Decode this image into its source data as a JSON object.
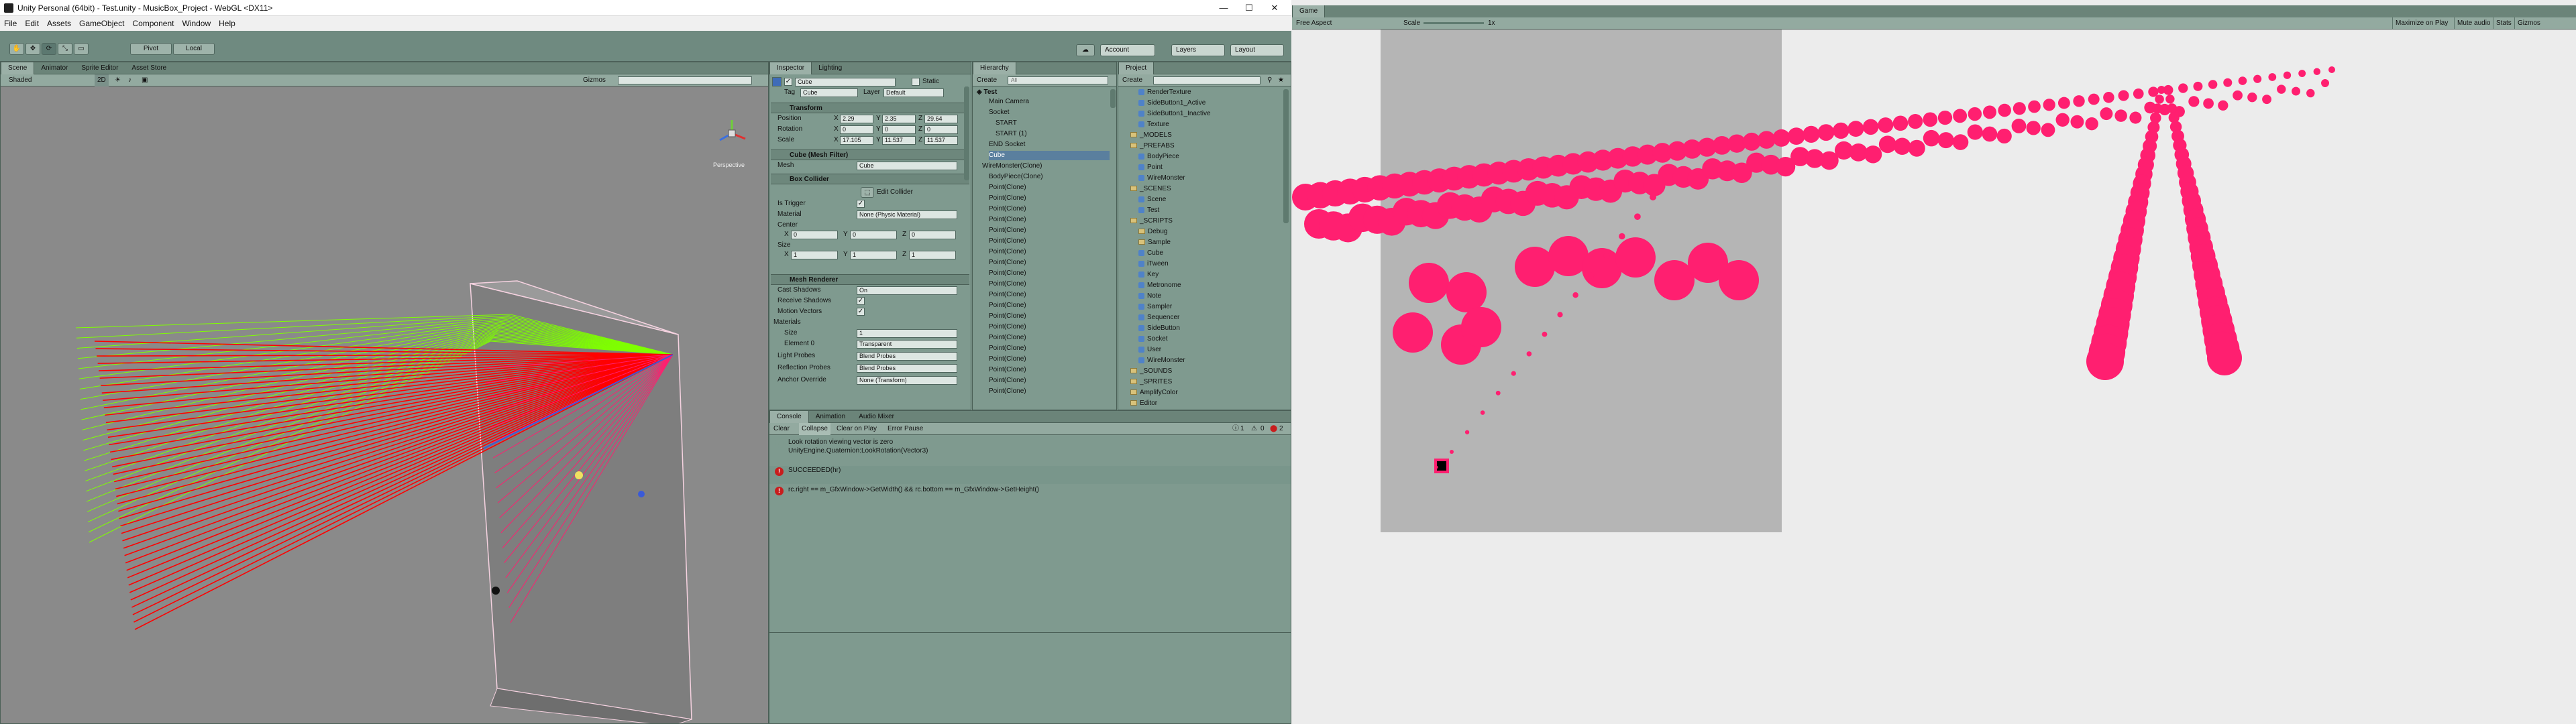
{
  "window": {
    "title": "Unity Personal (64bit) - Test.unity - MusicBox_Project - WebGL <DX11>",
    "controls": [
      "—",
      "☐",
      "✕"
    ]
  },
  "menu": [
    "File",
    "Edit",
    "Assets",
    "GameObject",
    "Component",
    "Window",
    "Help"
  ],
  "toolbar": {
    "pivot": "Pivot",
    "local": "Local",
    "account": "Account",
    "layers": "Layers",
    "layout": "Layout"
  },
  "scene": {
    "tabs": [
      "Scene",
      "Animator",
      "Sprite Editor",
      "Asset Store"
    ],
    "shading": "Shaded",
    "mode": "2D",
    "gizmos": "Gizmos",
    "orientation": "Perspective"
  },
  "inspector": {
    "tabs": [
      "Inspector",
      "Lighting"
    ],
    "object_name": "Cube",
    "static_label": "Static",
    "tag_label": "Tag",
    "tag_value": "Cube",
    "layer_label": "Layer",
    "layer_value": "Default",
    "transform": {
      "title": "Transform",
      "position_label": "Position",
      "position": [
        "2.29",
        "2.35",
        "29.64"
      ],
      "rotation_label": "Rotation",
      "rotation": [
        "0",
        "0",
        "0"
      ],
      "scale_label": "Scale",
      "scale": [
        "17.105",
        "11.537",
        "11.537"
      ]
    },
    "mesh_filter": {
      "title": "Cube (Mesh Filter)",
      "mesh_label": "Mesh",
      "mesh_value": "Cube"
    },
    "box_collider": {
      "title": "Box Collider",
      "edit_collider": "Edit Collider",
      "is_trigger_label": "Is Trigger",
      "material_label": "Material",
      "material_value": "None (Physic Material)",
      "center_label": "Center",
      "center": [
        "0",
        "0",
        "0"
      ],
      "size_label": "Size",
      "size": [
        "1",
        "1",
        "1"
      ]
    },
    "mesh_renderer": {
      "title": "Mesh Renderer",
      "cast_shadows_label": "Cast Shadows",
      "cast_shadows_value": "On",
      "receive_shadows_label": "Receive Shadows",
      "motion_vectors_label": "Motion Vectors",
      "materials_label": "Materials",
      "size_label": "Size",
      "size_value": "1",
      "element0_label": "Element 0",
      "element0_value": "Transparent",
      "light_probes_label": "Light Probes",
      "light_probes_value": "Blend Probes",
      "reflection_probes_label": "Reflection Probes",
      "reflection_probes_value": "Blend Probes",
      "anchor_override_label": "Anchor Override",
      "anchor_override_value": "None (Transform)"
    }
  },
  "hierarchy": {
    "tab": "Hierarchy",
    "create": "Create",
    "search_placeholder": "All",
    "scene_name": "Test",
    "items": [
      "Main Camera",
      "Socket",
      "START",
      "START (1)",
      "END Socket",
      "Cube",
      "WireMonster(Clone)",
      "BodyPiece(Clone)",
      "Point(Clone)",
      "Point(Clone)",
      "Point(Clone)",
      "Point(Clone)",
      "Point(Clone)",
      "Point(Clone)",
      "Point(Clone)",
      "Point(Clone)",
      "Point(Clone)",
      "Point(Clone)",
      "Point(Clone)",
      "Point(Clone)",
      "Point(Clone)",
      "Point(Clone)",
      "Point(Clone)",
      "Point(Clone)",
      "Point(Clone)",
      "Point(Clone)",
      "Point(Clone)",
      "Point(Clone)"
    ]
  },
  "project": {
    "tab": "Project",
    "create": "Create",
    "items": [
      {
        "name": "RenderTexture",
        "kind": "asset",
        "indent": 2
      },
      {
        "name": "SideButton1_Active",
        "kind": "asset",
        "indent": 2
      },
      {
        "name": "SideButton1_Inactive",
        "kind": "asset",
        "indent": 2
      },
      {
        "name": "Texture",
        "kind": "asset",
        "indent": 2
      },
      {
        "name": "_MODELS",
        "kind": "folder",
        "indent": 1
      },
      {
        "name": "_PREFABS",
        "kind": "folder",
        "indent": 1
      },
      {
        "name": "BodyPiece",
        "kind": "asset",
        "indent": 2
      },
      {
        "name": "Point",
        "kind": "asset",
        "indent": 2
      },
      {
        "name": "WireMonster",
        "kind": "asset",
        "indent": 2
      },
      {
        "name": "_SCENES",
        "kind": "folder",
        "indent": 1
      },
      {
        "name": "Scene",
        "kind": "asset",
        "indent": 2
      },
      {
        "name": "Test",
        "kind": "asset",
        "indent": 2
      },
      {
        "name": "_SCRIPTS",
        "kind": "folder",
        "indent": 1
      },
      {
        "name": "Debug",
        "kind": "folder",
        "indent": 2
      },
      {
        "name": "Sample",
        "kind": "folder",
        "indent": 2
      },
      {
        "name": "Cube",
        "kind": "asset",
        "indent": 2
      },
      {
        "name": "iTween",
        "kind": "asset",
        "indent": 2
      },
      {
        "name": "Key",
        "kind": "asset",
        "indent": 2
      },
      {
        "name": "Metronome",
        "kind": "asset",
        "indent": 2
      },
      {
        "name": "Note",
        "kind": "asset",
        "indent": 2
      },
      {
        "name": "Sampler",
        "kind": "asset",
        "indent": 2
      },
      {
        "name": "Sequencer",
        "kind": "asset",
        "indent": 2
      },
      {
        "name": "SideButton",
        "kind": "asset",
        "indent": 2
      },
      {
        "name": "Socket",
        "kind": "asset",
        "indent": 2
      },
      {
        "name": "User",
        "kind": "asset",
        "indent": 2
      },
      {
        "name": "WireMonster",
        "kind": "asset",
        "indent": 2
      },
      {
        "name": "_SOUNDS",
        "kind": "folder",
        "indent": 1
      },
      {
        "name": "_SPRITES",
        "kind": "folder",
        "indent": 1
      },
      {
        "name": "AmplifyColor",
        "kind": "folder",
        "indent": 1
      },
      {
        "name": "Editor",
        "kind": "folder",
        "indent": 1
      }
    ]
  },
  "console": {
    "tabs": [
      "Console",
      "Animation",
      "Audio Mixer"
    ],
    "buttons": [
      "Clear",
      "Collapse",
      "Clear on Play",
      "Error Pause"
    ],
    "counts": [
      "1",
      "0",
      "2"
    ],
    "messages": [
      {
        "kind": "warning",
        "lines": [
          "Look rotation viewing vector is zero",
          "UnityEngine.Quaternion:LookRotation(Vector3)"
        ]
      },
      {
        "kind": "error",
        "lines": [
          "SUCCEEDED(hr)"
        ]
      },
      {
        "kind": "error",
        "lines": [
          "rc.right == m_GfxWindow->GetWidth() && rc.bottom == m_GfxWindow->GetHeight()"
        ]
      }
    ]
  },
  "game": {
    "tab": "Game",
    "aspect": "Free Aspect",
    "scale_label": "Scale",
    "scale_value": "1x",
    "buttons": [
      "Maximize on Play",
      "Mute audio",
      "Stats",
      "Gizmos"
    ]
  },
  "colors": {
    "accent_pink": "#ff1f70",
    "ray_red": "#ff0000",
    "ray_green": "#7fff00",
    "panel_bg": "#7f9a8f",
    "scene_bg": "#8a8a8a",
    "game_plane": "#b5b5b5"
  }
}
